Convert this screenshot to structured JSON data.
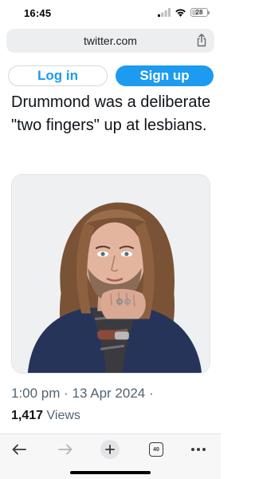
{
  "status_bar": {
    "time": "16:45",
    "battery": "28"
  },
  "address_bar": {
    "url": "twitter.com"
  },
  "auth": {
    "login_label": "Log in",
    "signup_label": "Sign up"
  },
  "tweet": {
    "text": "Drummond was a deliberate \"two fingers\" up at lesbians.",
    "timestamp": "1:00 pm · 13 Apr 2024 ·",
    "views_count": "1,417",
    "views_label": "Views"
  },
  "toolbar": {
    "tabs_count": "40"
  },
  "colors": {
    "twitter_blue": "#1d9bf0",
    "text_primary": "#0f1419",
    "text_secondary": "#536471"
  },
  "icons": [
    "signal-icon",
    "wifi-icon",
    "battery-icon",
    "share-icon",
    "back-arrow-icon",
    "forward-arrow-icon",
    "plus-icon",
    "tabs-icon",
    "more-icon"
  ]
}
